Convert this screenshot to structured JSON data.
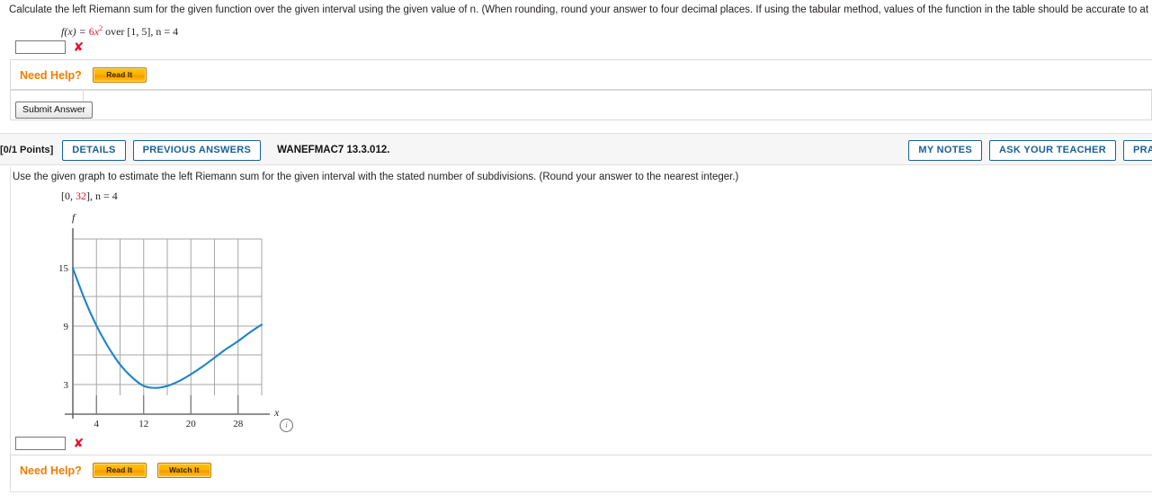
{
  "problem1": {
    "stem": "Calculate the left Riemann sum for the given function over the given interval using the given value of n. (When rounding, round your answer to four decimal places. If using the tabular method, values of the function in the table should be accurate to at least five decimal places.)",
    "function_prefix": "f(x) = ",
    "function_coef": "6",
    "function_var": "x",
    "function_exp": "2",
    "function_suffix": " over [1, 5], n = 4",
    "answer_value": "",
    "answer_mark": "✘",
    "need_help_label": "Need Help?",
    "read_it_label": "Read It",
    "submit_label": "Submit Answer"
  },
  "band": {
    "points": "[0/1 Points]",
    "details_label": "DETAILS",
    "previous_answers_label": "PREVIOUS ANSWERS",
    "question_code": "WANEFMAC7 13.3.012.",
    "my_notes_label": "MY NOTES",
    "ask_your_teacher_label": "ASK YOUR TEACHER",
    "practice_another_label": "PRACTICE ANOTHER"
  },
  "problem2": {
    "stem": "Use the given graph to estimate the left Riemann sum for the given interval with the stated number of subdivisions. (Round your answer to the nearest integer.)",
    "interval_open": "[0, ",
    "interval_red": "32",
    "interval_close": "], n = 4",
    "answer_value": "",
    "answer_mark": "✘",
    "need_help_label": "Need Help?",
    "read_it_label": "Read It",
    "watch_it_label": "Watch It",
    "info_icon_label": "i"
  },
  "chart_data": {
    "type": "line",
    "title": "",
    "xlabel": "x",
    "ylabel": "f",
    "xlim": [
      0,
      32
    ],
    "ylim": [
      0,
      18
    ],
    "xticks": [
      4,
      12,
      20,
      28
    ],
    "yticks": [
      3,
      9,
      15
    ],
    "xgrid": [
      4,
      8,
      12,
      16,
      20,
      24,
      28,
      32
    ],
    "ygrid": [
      3,
      6,
      9,
      12,
      15,
      18
    ],
    "grid": true,
    "legend": "none",
    "line_color": "#1f84c8",
    "series": [
      {
        "name": "f",
        "x": [
          0,
          2,
          4,
          6,
          8,
          10,
          12,
          14,
          16,
          18,
          20,
          22,
          24,
          26,
          28,
          30,
          32
        ],
        "y": [
          15.0,
          11.8,
          9.1,
          6.9,
          5.1,
          3.8,
          2.9,
          2.7,
          2.9,
          3.4,
          4.1,
          4.9,
          5.8,
          6.7,
          7.5,
          8.4,
          9.2
        ]
      }
    ]
  }
}
